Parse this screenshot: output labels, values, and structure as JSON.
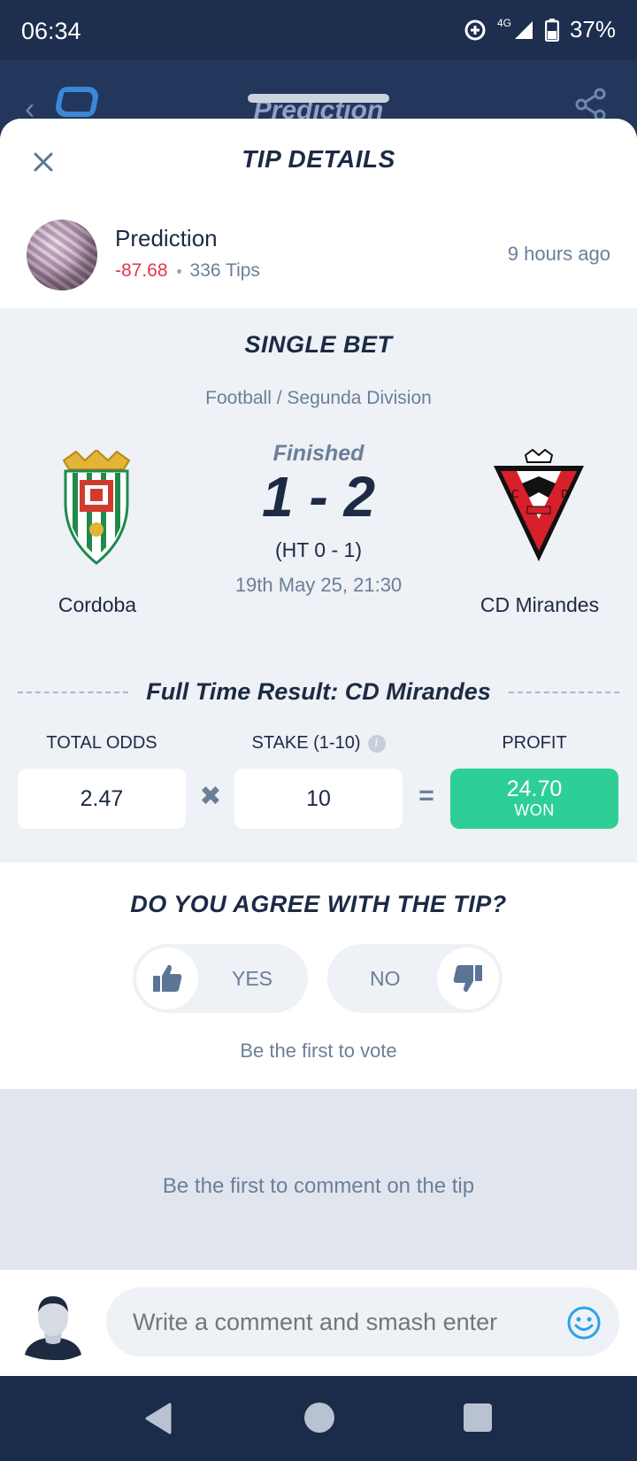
{
  "status_bar": {
    "time": "06:34",
    "network": "4G",
    "battery": "37%"
  },
  "app_header": {
    "title": "Prediction"
  },
  "sheet": {
    "title": "TIP DETAILS"
  },
  "tipster": {
    "name": "Prediction",
    "profit": "-87.68",
    "tips": "336 Tips",
    "posted": "9 hours ago"
  },
  "bet": {
    "type": "SINGLE BET",
    "league": "Football / Segunda Division",
    "status": "Finished",
    "score": "1 - 2",
    "halftime": "(HT 0 - 1)",
    "date": "19th May 25, 21:30",
    "home_team": "Cordoba",
    "away_team": "CD Mirandes",
    "pick": "Full Time Result: CD Mirandes",
    "odds_label": "TOTAL ODDS",
    "odds": "2.47",
    "stake_label": "STAKE (1-10)",
    "stake": "10",
    "profit_label": "PROFIT",
    "profit": "24.70",
    "outcome": "WON",
    "multiply_symbol": "✖",
    "equals_symbol": "="
  },
  "vote": {
    "title": "DO YOU AGREE WITH THE TIP?",
    "yes": "YES",
    "no": "NO",
    "hint": "Be the first to vote"
  },
  "comments": {
    "empty_text": "Be the first to comment on the tip",
    "placeholder": "Write a comment and smash enter"
  },
  "colors": {
    "navy": "#1c2a44",
    "muted": "#6b7f99",
    "negative": "#e2384b",
    "won": "#2ecf96",
    "emoji": "#2aa3e8"
  },
  "icons": [
    "close-icon",
    "share-icon",
    "info-icon",
    "thumbs-up-icon",
    "thumbs-down-icon",
    "smiley-icon",
    "back-icon",
    "home-icon",
    "recents-icon"
  ]
}
